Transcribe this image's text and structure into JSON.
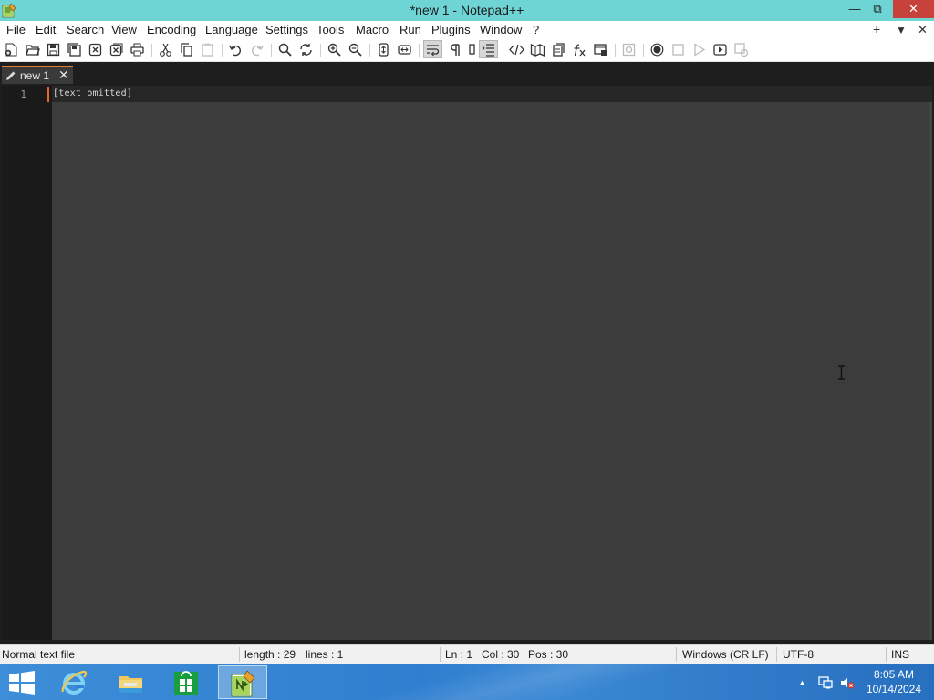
{
  "window": {
    "title": "*new 1 - Notepad++",
    "min_glyph": "—",
    "max_glyph": "⧉",
    "close_glyph": "✕"
  },
  "menu": {
    "items": [
      "File",
      "Edit",
      "Search",
      "View",
      "Encoding",
      "Language",
      "Settings",
      "Tools",
      "Macro",
      "Run",
      "Plugins",
      "Window",
      "?"
    ],
    "right_add": "+",
    "right_dropdown": "▼",
    "right_close": "✕"
  },
  "toolbar": {
    "icons": [
      "new-file-icon",
      "open-file-icon",
      "save-icon",
      "save-all-icon",
      "close-icon",
      "close-all-icon",
      "print-icon",
      "cut-icon",
      "copy-icon",
      "paste-icon",
      "undo-icon",
      "redo-icon",
      "find-icon",
      "replace-icon",
      "zoom-in-icon",
      "zoom-out-icon",
      "sync-vertical-icon",
      "sync-horizontal-icon",
      "word-wrap-icon",
      "show-all-characters-icon",
      "indent-guide-icon",
      "function-list-icon",
      "xml-tag-icon",
      "document-map-icon",
      "document-list-icon",
      "function-fx-icon",
      "folder-workspace-icon",
      "monitoring-icon",
      "record-macro-icon",
      "stop-record-icon",
      "playback-macro-icon",
      "run-macro-multiple-icon",
      "save-macro-icon"
    ],
    "active": [
      "word-wrap-icon",
      "indent-guide-icon"
    ]
  },
  "tab": {
    "label": "new 1",
    "close_glyph": "✕"
  },
  "editor": {
    "line_number": "1",
    "line_text": "[text omitted]"
  },
  "status": {
    "file_type": "Normal text file",
    "length": "length : 29",
    "lines": "lines : 1",
    "ln": "Ln : 1",
    "col": "Col : 30",
    "pos": "Pos : 30",
    "eol": "Windows (CR LF)",
    "encoding": "UTF-8",
    "mode": "INS"
  },
  "taskbar": {
    "apps": [
      "internet-explorer-icon",
      "file-explorer-icon",
      "store-icon",
      "notepad-plus-plus-icon"
    ],
    "active_app": "notepad-plus-plus-icon",
    "tray_icons": [
      "tray-overflow-icon",
      "network-icon",
      "volume-muted-icon"
    ],
    "tray_overflow_glyph": "▲",
    "time": "8:05 AM",
    "date": "10/14/2024"
  },
  "colors": {
    "titlebar": "#6fd4d4",
    "close_button": "#c7423a",
    "editor_bg": "#3c3c3c",
    "gutter_bg": "#1a1a1a",
    "tab_accent": "#e38030",
    "caret_marker": "#e8642c",
    "taskbar": "#3182d2"
  }
}
